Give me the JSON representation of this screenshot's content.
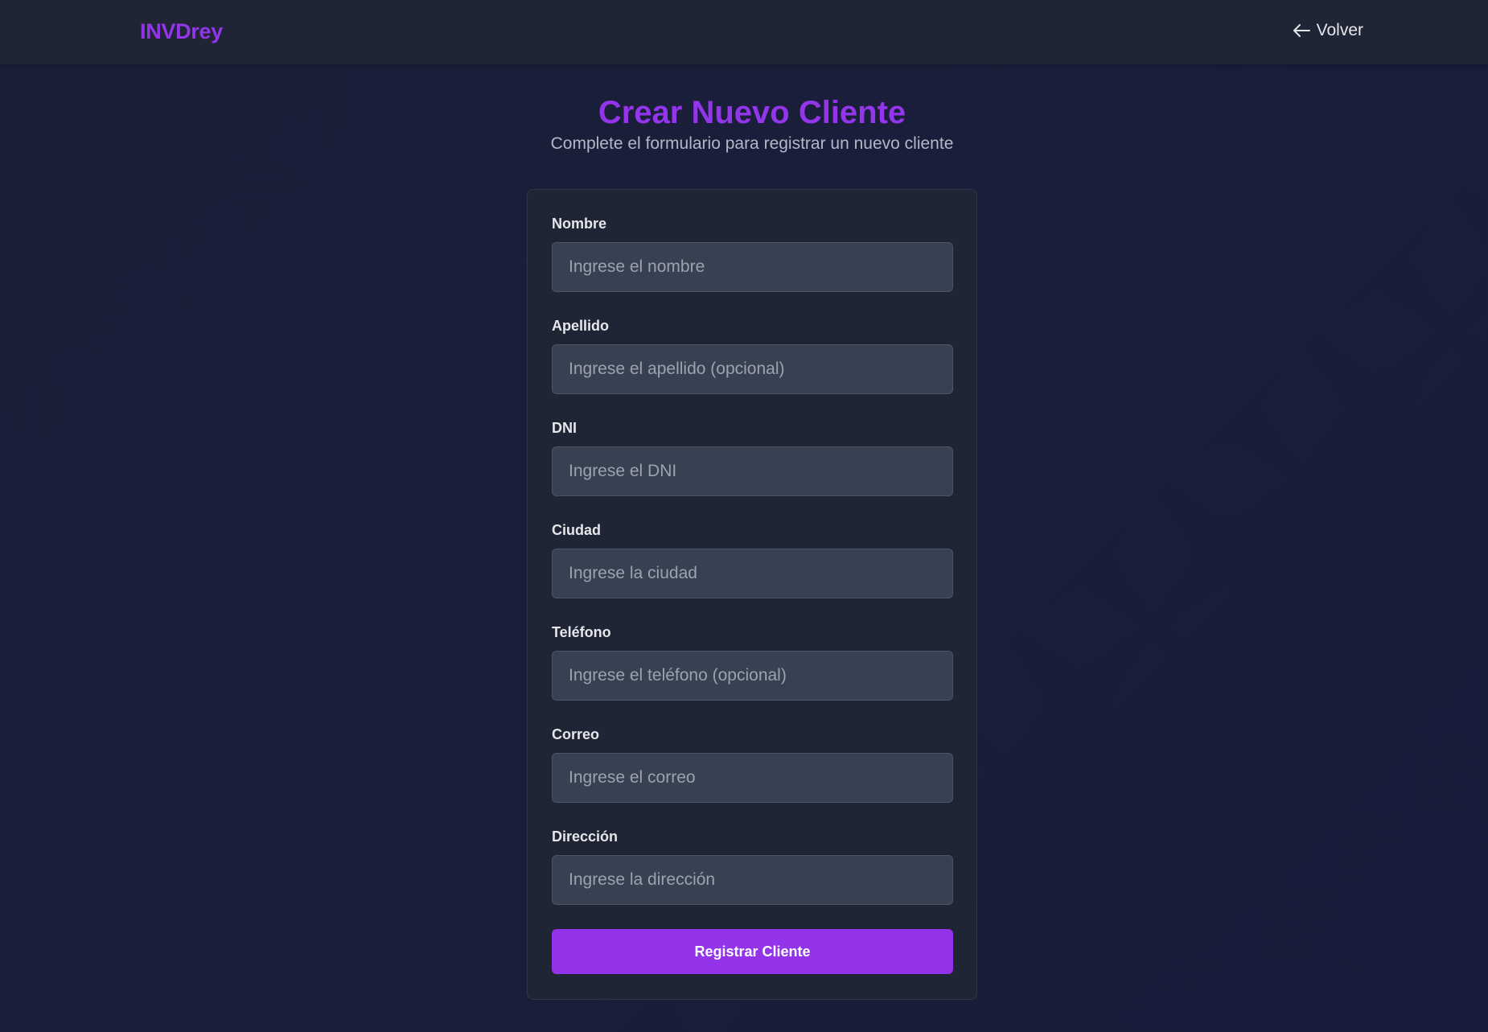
{
  "navbar": {
    "brand": "INVDrey",
    "back_label": "Volver",
    "back_icon": "arrow-left-icon"
  },
  "header": {
    "title": "Crear Nuevo Cliente",
    "subtitle": "Complete el formulario para registrar un nuevo cliente"
  },
  "form": {
    "fields": [
      {
        "label": "Nombre",
        "placeholder": "Ingrese el nombre",
        "value": ""
      },
      {
        "label": "Apellido",
        "placeholder": "Ingrese el apellido (opcional)",
        "value": ""
      },
      {
        "label": "DNI",
        "placeholder": "Ingrese el DNI",
        "value": ""
      },
      {
        "label": "Ciudad",
        "placeholder": "Ingrese la ciudad",
        "value": ""
      },
      {
        "label": "Teléfono",
        "placeholder": "Ingrese el teléfono (opcional)",
        "value": ""
      },
      {
        "label": "Correo",
        "placeholder": "Ingrese el correo",
        "value": ""
      },
      {
        "label": "Dirección",
        "placeholder": "Ingrese la dirección",
        "value": ""
      }
    ],
    "submit_label": "Registrar Cliente"
  },
  "colors": {
    "accent": "#9333ea",
    "background": "#1a1e3a",
    "card": "#1f2535",
    "input": "#374151"
  }
}
